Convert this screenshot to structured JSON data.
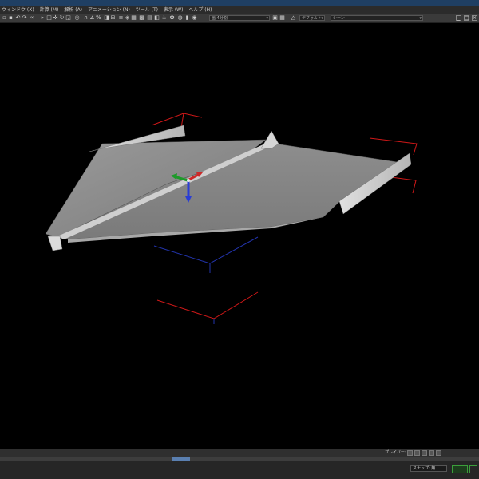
{
  "menubar": {
    "items": [
      "ウィンドウ (X)",
      "計算 (M)",
      "解析 (A)",
      "アニメーション (N)",
      "ツール (T)",
      "表示 (W)",
      "ヘルプ (H)"
    ]
  },
  "toolbar": {
    "view_dropdown": "画:4分割",
    "preset_dropdown": "デフォルト",
    "scene_dropdown": "シーン"
  },
  "timeline": {
    "playback_label": "プレイバー:"
  },
  "status": {
    "snap_label": "スナップ: 無"
  },
  "colors": {
    "accent": "#5a7fb0",
    "gizmo_x": "#cc2a2a",
    "gizmo_y": "#1e9a2a",
    "gizmo_z": "#2a3dd6",
    "bbox_red": "#d01818",
    "bbox_blue": "#2233aa",
    "bbox_green": "#1a8a1a"
  },
  "icons": [
    "minimize-icon",
    "maximize-icon",
    "close-icon",
    "gizmo-icon",
    "play-icon",
    "snap-icon"
  ]
}
